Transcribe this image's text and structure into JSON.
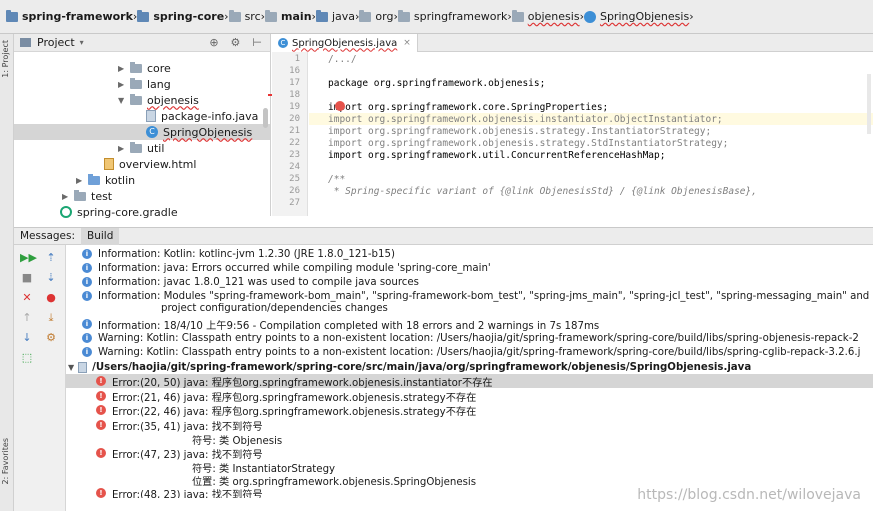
{
  "breadcrumb": [
    "spring-framework",
    "spring-core",
    "src",
    "main",
    "java",
    "org",
    "springframework",
    "objenesis",
    "SpringObjenesis"
  ],
  "sidebar": {
    "project_label": "1: Project",
    "favorites_label": "2: Favorites"
  },
  "project": {
    "title": "Project",
    "tree": [
      "core",
      "lang",
      "objenesis",
      "package-info.java",
      "SpringObjenesis",
      "util",
      "overview.html",
      "kotlin",
      "test",
      "spring-core.gradle"
    ]
  },
  "editor": {
    "tab": "SpringObjenesis.java",
    "lines": [
      {
        "n": "1",
        "t": "/.../"
      },
      {
        "n": "16",
        "t": ""
      },
      {
        "n": "17",
        "t": "package org.springframework.objenesis;"
      },
      {
        "n": "18",
        "t": ""
      },
      {
        "n": "19",
        "t": "import org.springframework.core.SpringProperties;"
      },
      {
        "n": "20",
        "t": "import org.springframework.objenesis.instantiator.ObjectInstantiator;"
      },
      {
        "n": "21",
        "t": "import org.springframework.objenesis.strategy.InstantiatorStrategy;"
      },
      {
        "n": "22",
        "t": "import org.springframework.objenesis.strategy.StdInstantiatorStrategy;"
      },
      {
        "n": "23",
        "t": "import org.springframework.util.ConcurrentReferenceHashMap;"
      },
      {
        "n": "24",
        "t": ""
      },
      {
        "n": "25",
        "t": "/**"
      },
      {
        "n": "26",
        "t": " * Spring-specific variant of {@link ObjenesisStd} / {@link ObjenesisBase},"
      },
      {
        "n": "27",
        "t": ""
      }
    ]
  },
  "messages": {
    "tabs": [
      "Messages:",
      "Build"
    ],
    "rows": [
      {
        "level": "info",
        "text": "Information: Kotlin: kotlinc-jvm 1.2.30 (JRE 1.8.0_121-b15)"
      },
      {
        "level": "info",
        "text": "Information: java: Errors occurred while compiling module 'spring-core_main'"
      },
      {
        "level": "info",
        "text": "Information: javac 1.8.0_121 was used to compile java sources"
      },
      {
        "level": "info",
        "text": "Information: Modules \"spring-framework-bom_main\", \"spring-framework-bom_test\", \"spring-jms_main\", \"spring-jcl_test\", \"spring-messaging_main\" and"
      },
      {
        "level": "cont",
        "text": "project configuration/dependencies changes"
      },
      {
        "level": "info",
        "text": "Information: 18/4/10 上午9:56 - Compilation completed with 18 errors and 2 warnings in 7s 187ms"
      },
      {
        "level": "warn",
        "text": "Warning: Kotlin: Classpath entry points to a non-existent location: /Users/haojia/git/spring-framework/spring-core/build/libs/spring-objenesis-repack-2"
      },
      {
        "level": "warn",
        "text": "Warning: Kotlin: Classpath entry points to a non-existent location: /Users/haojia/git/spring-framework/spring-core/build/libs/spring-cglib-repack-3.2.6.j"
      },
      {
        "level": "file",
        "text": "/Users/haojia/git/spring-framework/spring-core/src/main/java/org/springframework/objenesis/SpringObjenesis.java"
      },
      {
        "level": "err",
        "text": "Error:(20, 50)  java: 程序包org.springframework.objenesis.instantiator不存在"
      },
      {
        "level": "err",
        "text": "Error:(21, 46)  java: 程序包org.springframework.objenesis.strategy不存在"
      },
      {
        "level": "err",
        "text": "Error:(22, 46)  java: 程序包org.springframework.objenesis.strategy不存在"
      },
      {
        "level": "err",
        "text": "Error:(35, 41)  java: 找不到符号"
      },
      {
        "level": "cont",
        "text": "符号: 类 Objenesis"
      },
      {
        "level": "err",
        "text": "Error:(47, 23)  java: 找不到符号"
      },
      {
        "level": "cont",
        "text": "符号:   类 InstantiatorStrategy"
      },
      {
        "level": "cont",
        "text": "位置: 类 org.springframework.objenesis.SpringObjenesis"
      },
      {
        "level": "err",
        "text": "Error:(48, 23)  java: 找不到符号"
      }
    ]
  },
  "watermark": "https://blog.csdn.net/wilovejava"
}
